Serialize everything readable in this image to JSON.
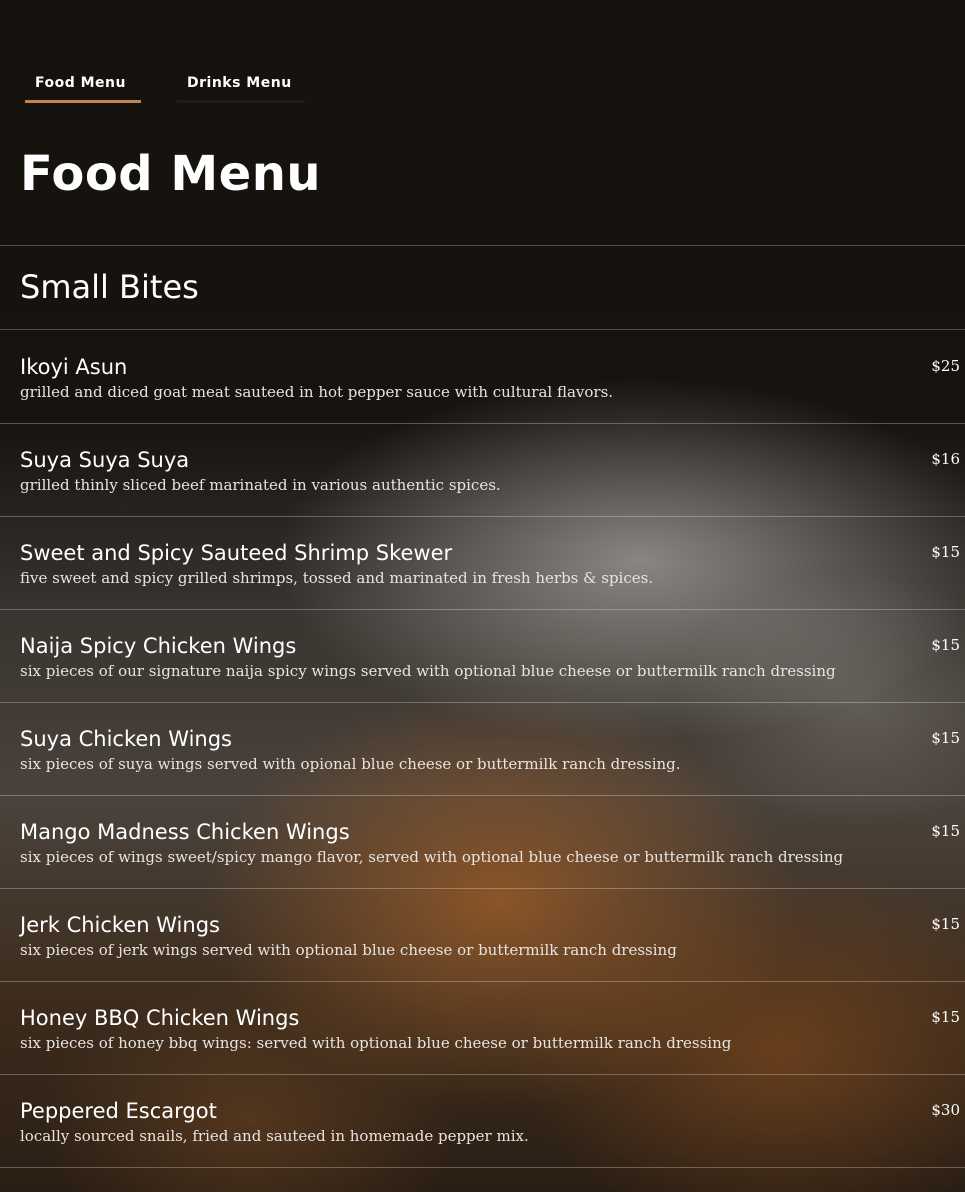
{
  "tabs": [
    {
      "label": "Food Menu",
      "active": true
    },
    {
      "label": "Drinks Menu",
      "active": false
    }
  ],
  "page_title": "Food Menu",
  "section": {
    "title": "Small Bites"
  },
  "items": [
    {
      "name": "Ikoyi Asun",
      "description": "grilled and diced goat meat sauteed in hot pepper sauce with cultural flavors.",
      "price": "$25"
    },
    {
      "name": "Suya Suya Suya",
      "description": "grilled thinly sliced beef marinated in various authentic spices.",
      "price": "$16"
    },
    {
      "name": "Sweet and Spicy Sauteed Shrimp Skewer",
      "description": "five sweet and spicy grilled shrimps, tossed and marinated in fresh herbs & spices.",
      "price": "$15"
    },
    {
      "name": "Naija Spicy Chicken Wings",
      "description": "six pieces of our signature naija spicy wings served with optional blue cheese or buttermilk ranch dressing",
      "price": "$15"
    },
    {
      "name": "Suya Chicken Wings",
      "description": "six pieces of suya wings served with opional blue cheese or buttermilk ranch dressing.",
      "price": "$15"
    },
    {
      "name": "Mango Madness Chicken Wings",
      "description": "six pieces of wings sweet/spicy mango flavor, served with optional blue cheese or buttermilk ranch dressing",
      "price": "$15"
    },
    {
      "name": "Jerk Chicken Wings",
      "description": "six pieces of jerk wings served with optional blue cheese or buttermilk ranch dressing",
      "price": "$15"
    },
    {
      "name": "Honey BBQ Chicken Wings",
      "description": "six pieces of honey bbq wings: served with optional blue cheese or buttermilk ranch dressing",
      "price": "$15"
    },
    {
      "name": "Peppered Escargot",
      "description": "locally sourced snails, fried and sauteed in homemade pepper mix.",
      "price": "$30"
    }
  ],
  "colors": {
    "background": "#15110e",
    "active_tab_underline": "#c4834f",
    "text": "#ffffff"
  }
}
